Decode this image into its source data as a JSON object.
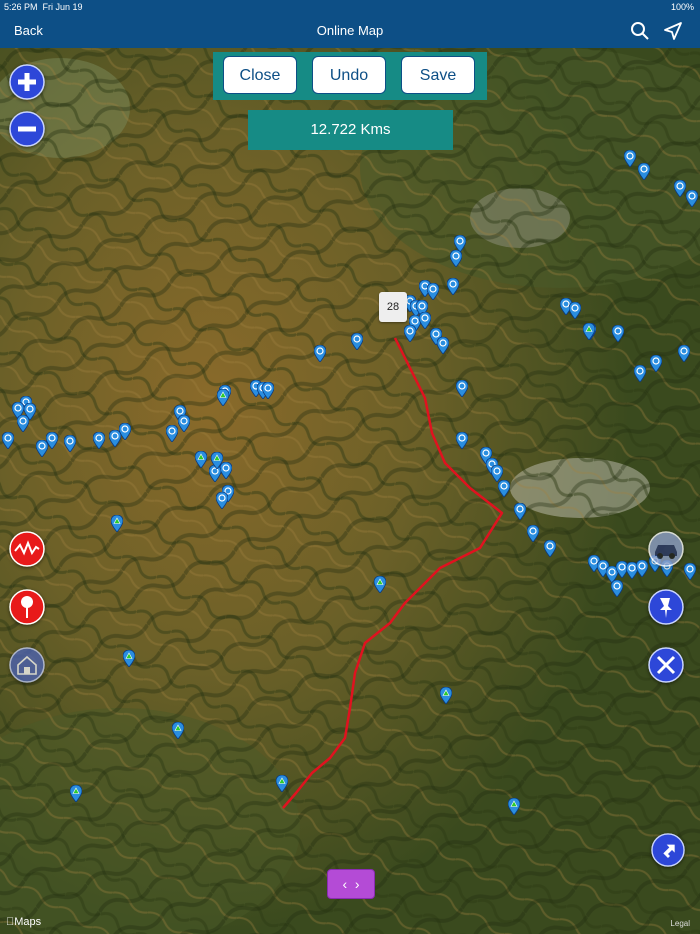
{
  "status": {
    "time": "5:26 PM",
    "date": "Fri Jun 19",
    "battery": "100%"
  },
  "nav": {
    "back": "Back",
    "title": "Online Map"
  },
  "toolbar": {
    "close": "Close",
    "undo": "Undo",
    "save": "Save"
  },
  "distance": "12.722 Kms",
  "marker_label": "28",
  "footer": {
    "maps": "Maps",
    "legal": "Legal"
  },
  "colors": {
    "nav": "#0d4f86",
    "teal": "#168b85",
    "route": "#e0121f",
    "pin": "#2a8ee0"
  },
  "icons": [
    "zoom-in-icon",
    "zoom-out-icon",
    "track-icon",
    "pin-drop-icon",
    "house-icon",
    "car-icon",
    "pushpin-icon",
    "tools-icon",
    "locate-icon",
    "search-icon",
    "location-arrow-icon"
  ]
}
